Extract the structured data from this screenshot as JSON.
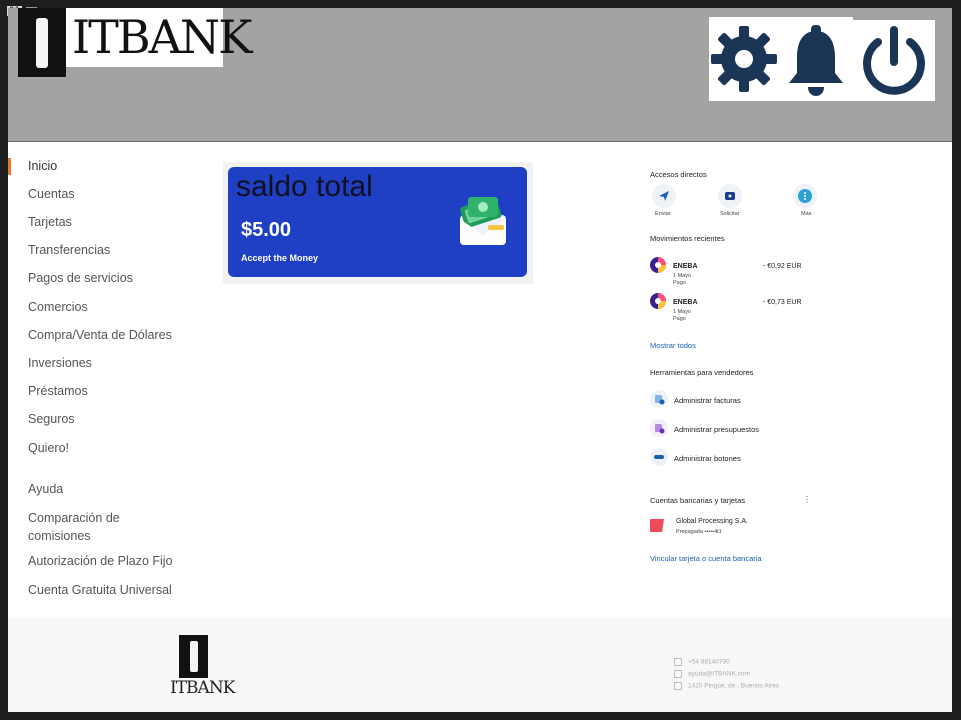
{
  "overlay": {
    "tag": "01"
  },
  "brand": {
    "name": "ITBANK"
  },
  "header": {
    "icons": [
      "gear-icon",
      "bell-icon",
      "power-icon"
    ],
    "icon_color": "#1b3557"
  },
  "sidebar": {
    "items": [
      {
        "label": "Inicio",
        "active": true
      },
      {
        "label": "Cuentas"
      },
      {
        "label": "Tarjetas"
      },
      {
        "label": "Transferencias"
      },
      {
        "label": "Pagos de servicios"
      },
      {
        "label": "Comercios"
      },
      {
        "label": "Compra/Venta de Dólares"
      },
      {
        "label": "Inversiones"
      },
      {
        "label": "Préstamos"
      },
      {
        "label": "Seguros"
      },
      {
        "label": "Quiero!"
      }
    ],
    "secondary": [
      {
        "label": "Ayuda"
      },
      {
        "label": "Comparación de comisiones"
      },
      {
        "label": "Autorización de Plazo Fijo"
      },
      {
        "label": "Cuenta Gratuita Universal"
      }
    ],
    "active_color": "#e8792b"
  },
  "balance_card": {
    "title": "saldo total",
    "amount": "$5.00",
    "action": "Accept the Money",
    "icon": "money-envelope-icon",
    "color": "#1f3fc4"
  },
  "right_panel": {
    "quick_access": {
      "title": "Accesos directos",
      "items": [
        {
          "label": "Enviar",
          "icon": "send-icon"
        },
        {
          "label": "Solicitar",
          "icon": "request-icon"
        },
        {
          "label": "Más",
          "icon": "more-icon"
        }
      ]
    },
    "recent": {
      "title": "Movimientos recientes",
      "items": [
        {
          "merchant": "ENEBA",
          "date": "1 Mayo",
          "type": "Pago",
          "amount": "- €0,92 EUR"
        },
        {
          "merchant": "ENEBA",
          "date": "1 Mayo",
          "type": "Pago",
          "amount": "- €0,73 EUR"
        }
      ],
      "show_all": "Mostrar todos"
    },
    "seller_tools": {
      "title": "Herramientas para vendedores",
      "items": [
        {
          "label": "Administrar facturas",
          "icon": "invoice-icon"
        },
        {
          "label": "Administrar presupuestos",
          "icon": "estimate-icon"
        },
        {
          "label": "Administrar botones",
          "icon": "buttons-icon"
        }
      ]
    },
    "bank_accounts": {
      "title": "Cuentas bancarias y tarjetas",
      "menu_icon": "kebab-menu-icon",
      "card_name": "Global Processing S.A.",
      "card_detail": "Prepagada •••••4t1",
      "link": "Vincular tarjeta o cuenta bancaria"
    }
  },
  "footer": {
    "brand": "ITBANK",
    "phone": "+54 88140790",
    "email": "ayuda@ITBANK.com",
    "address": "1420 Pingüe, de , Buenos Aires"
  }
}
